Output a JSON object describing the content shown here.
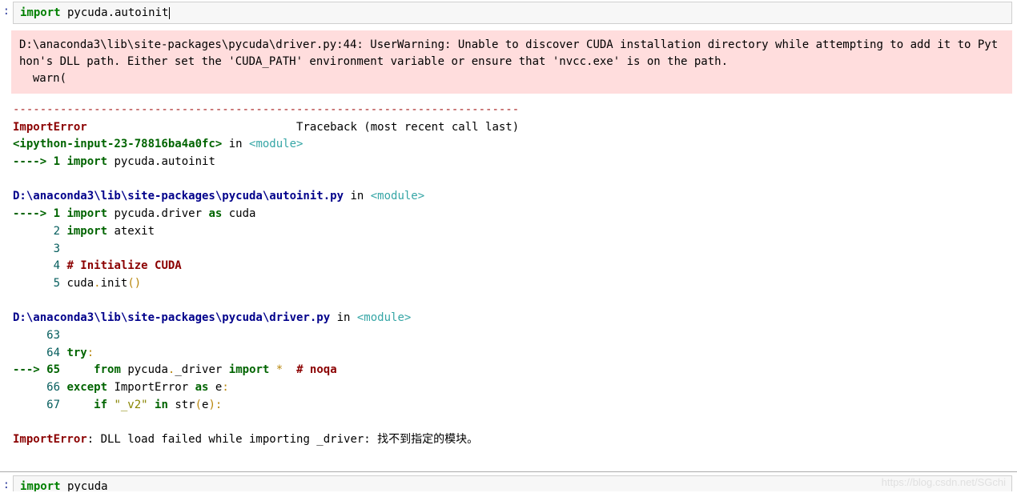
{
  "cell1": {
    "prompt": ":",
    "code_kw": "import",
    "code_rest": " pycuda.autoinit"
  },
  "warning": {
    "line1": "D:\\anaconda3\\lib\\site-packages\\pycuda\\driver.py:44: UserWarning: Unable to discover CUDA installation directory while attempting to add it to Python's DLL path. Either set the 'CUDA_PATH' environment variable or ensure that 'nvcc.exe' is on the path.",
    "line2": "  warn("
  },
  "traceback": {
    "separator": "---------------------------------------------------------------------------",
    "err_name": "ImportError",
    "tb_header_rest": "                               Traceback (most recent call last)",
    "frame1_loc": "<ipython-input-23-78816ba4a0fc>",
    "in_word": " in ",
    "module_tag": "<module>",
    "arrow": "----> ",
    "f1_lineno": "1 ",
    "f1_import": "import",
    "f1_rest": " pycuda.autoinit",
    "frame2_path": "D:\\anaconda3\\lib\\site-packages\\pycuda\\autoinit.py",
    "f2_l1_arrow": "----> ",
    "f2_l1_no": "1 ",
    "f2_l1_import": "import",
    "f2_l1_mid": " pycuda.driver ",
    "f2_l1_as": "as",
    "f2_l1_end": " cuda",
    "f2_l2_no": "      2 ",
    "f2_l2_import": "import",
    "f2_l2_end": " atexit",
    "f2_l3": "      3 ",
    "f2_l4_no": "      4 ",
    "f2_l4_comment": "# Initialize CUDA",
    "f2_l5_no": "      5 ",
    "f2_l5_a": "cuda",
    "f2_l5_dot": ".",
    "f2_l5_b": "init",
    "f2_l5_paren": "()",
    "frame3_path": "D:\\anaconda3\\lib\\site-packages\\pycuda\\driver.py",
    "f3_l63": "     63 ",
    "f3_l64_no": "     64 ",
    "f3_l64_try": "try",
    "f3_l64_colon": ":",
    "f3_l65_arrow": "---> ",
    "f3_l65_no": "65     ",
    "f3_l65_from": "from",
    "f3_l65_mid1": " pycuda",
    "f3_l65_dot": ".",
    "f3_l65_mid2": "_driver ",
    "f3_l65_import": "import",
    "f3_l65_star": " *  ",
    "f3_l65_comment": "# noqa",
    "f3_l66_no": "     66 ",
    "f3_l66_except": "except",
    "f3_l66_mid": " ImportError ",
    "f3_l66_as": "as",
    "f3_l66_e": " e",
    "f3_l66_colon": ":",
    "f3_l67_no": "     67     ",
    "f3_l67_if": "if",
    "f3_l67_str": " \"_v2\" ",
    "f3_l67_in": "in",
    "f3_l67_call": " str",
    "f3_l67_paren_o": "(",
    "f3_l67_arg": "e",
    "f3_l67_paren_c": ")",
    "f3_l67_colon": ":",
    "final_err": "ImportError",
    "final_msg": ": DLL load failed while importing _driver: 找不到指定的模块。"
  },
  "cell2": {
    "prompt": ":",
    "code_kw": "import",
    "code_rest": " pycuda"
  },
  "watermark": "https://blog.csdn.net/SGchi"
}
